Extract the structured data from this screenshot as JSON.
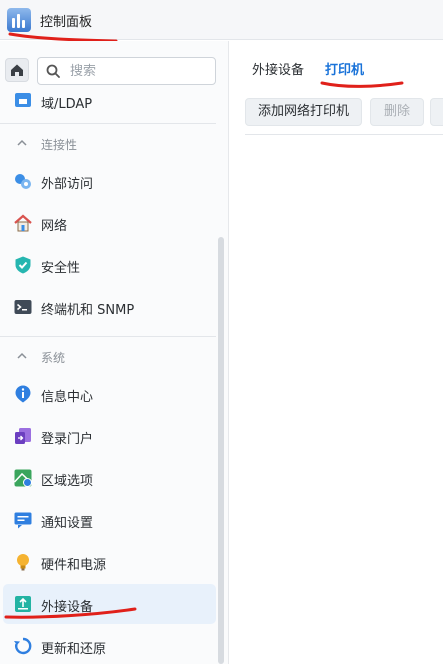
{
  "window": {
    "title": "控制面板"
  },
  "search": {
    "placeholder": "搜索"
  },
  "sidebar": {
    "top_item": "域/LDAP",
    "sections": [
      {
        "label": "连接性",
        "items": [
          {
            "label": "外部访问",
            "icon": "external-access-icon"
          },
          {
            "label": "网络",
            "icon": "network-house-icon"
          },
          {
            "label": "安全性",
            "icon": "shield-check-icon"
          },
          {
            "label": "终端机和 SNMP",
            "icon": "terminal-icon"
          }
        ]
      },
      {
        "label": "系统",
        "items": [
          {
            "label": "信息中心",
            "icon": "info-icon"
          },
          {
            "label": "登录门户",
            "icon": "login-portal-icon"
          },
          {
            "label": "区域选项",
            "icon": "regional-options-icon"
          },
          {
            "label": "通知设置",
            "icon": "notification-icon"
          },
          {
            "label": "硬件和电源",
            "icon": "bulb-icon"
          },
          {
            "label": "外接设备",
            "icon": "external-device-icon",
            "active": true
          },
          {
            "label": "更新和还原",
            "icon": "update-restore-icon"
          }
        ]
      }
    ]
  },
  "tabs": [
    {
      "label": "外接设备",
      "active": false
    },
    {
      "label": "打印机",
      "active": true
    }
  ],
  "toolbar": {
    "add_network_printer": "添加网络打印机",
    "delete": "删除"
  },
  "colors": {
    "accent": "#1a73d9",
    "active_bg": "#e8f1fb",
    "annotation_red": "#e0201a"
  }
}
